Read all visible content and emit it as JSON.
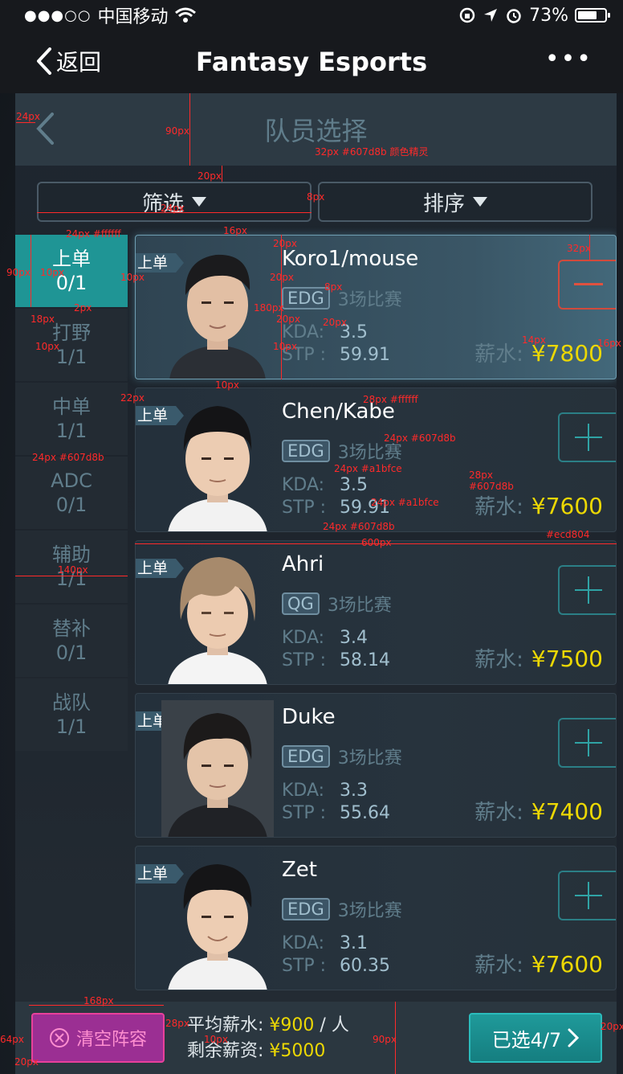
{
  "status_bar": {
    "signal": "●●●○○",
    "carrier": "中国移动",
    "battery_pct": "73%",
    "battery_level": 0.73
  },
  "nav": {
    "back_label": "返回",
    "title": "Fantasy Esports",
    "more": "•••"
  },
  "subheader": {
    "title": "队员选择"
  },
  "filters": {
    "filter_label": "筛选",
    "sort_label": "排序"
  },
  "positions": [
    {
      "name": "上单",
      "count": "0/1",
      "active": true
    },
    {
      "name": "打野",
      "count": "1/1"
    },
    {
      "name": "中单",
      "count": "1/1"
    },
    {
      "name": "ADC",
      "count": "0/1"
    },
    {
      "name": "辅助",
      "count": "1/1"
    },
    {
      "name": "替补",
      "count": "0/1"
    },
    {
      "name": "战队",
      "count": "1/1"
    }
  ],
  "players": [
    {
      "tag": "上单",
      "name": "Koro1/mouse",
      "team": "EDG",
      "games": "3场比赛",
      "kda_label": "KDA:",
      "kda": "3.5",
      "stp_label": "STP :",
      "stp": "59.91",
      "salary_label": "薪水:",
      "salary": "¥7800",
      "selected": true
    },
    {
      "tag": "上单",
      "name": "Chen/Kabe",
      "team": "EDG",
      "games": "3场比赛",
      "kda_label": "KDA:",
      "kda": "3.5",
      "stp_label": "STP :",
      "stp": "59.91",
      "salary_label": "薪水:",
      "salary": "¥7600"
    },
    {
      "tag": "上单",
      "name": "Ahri",
      "team": "QG",
      "games": "3场比赛",
      "kda_label": "KDA:",
      "kda": "3.4",
      "stp_label": "STP :",
      "stp": "58.14",
      "salary_label": "薪水:",
      "salary": "¥7500"
    },
    {
      "tag": "上单",
      "name": "Duke",
      "team": "EDG",
      "games": "3场比赛",
      "kda_label": "KDA:",
      "kda": "3.3",
      "stp_label": "STP :",
      "stp": "55.64",
      "salary_label": "薪水:",
      "salary": "¥7400"
    },
    {
      "tag": "上单",
      "name": "Zet",
      "team": "EDG",
      "games": "3场比赛",
      "kda_label": "KDA:",
      "kda": "3.1",
      "stp_label": "STP :",
      "stp": "60.35",
      "salary_label": "薪水:",
      "salary": "¥7600"
    }
  ],
  "bottom": {
    "clear_label": "清空阵容",
    "avg_label": "平均薪水:",
    "avg_value": "¥900",
    "avg_unit": " / 人",
    "remain_label": "剩余薪资:",
    "remain_value": "¥5000",
    "selected_label": "已选4/7"
  },
  "colors": {
    "accent_teal": "#1f9595",
    "muted": "#607d8b",
    "light_blue": "#a1bfce",
    "gold": "#ecd804",
    "pink": "#e9409b"
  },
  "annotations": [
    "24px",
    "90px",
    "32px #607d8b 颜色精灵",
    "20px",
    "24px",
    "8px",
    "16px",
    "20px",
    "32px",
    "24px #ffffff",
    "90px",
    "10px",
    "10px",
    "20px",
    "8px",
    "180px",
    "2px",
    "20px",
    "20px",
    "18px",
    "10px",
    "10px",
    "14px",
    "16px",
    "10px",
    "22px",
    "28px #ffffff",
    "24px #607d8b",
    "24px #607d8b",
    "24px #a1bfce",
    "28px",
    "#607d8b",
    "24px #a1bfce",
    "24px #607d8b",
    "#ecd804",
    "600px",
    "140px",
    "168px",
    "64px",
    "28px",
    "10px",
    "90px",
    "20px",
    "20px"
  ]
}
